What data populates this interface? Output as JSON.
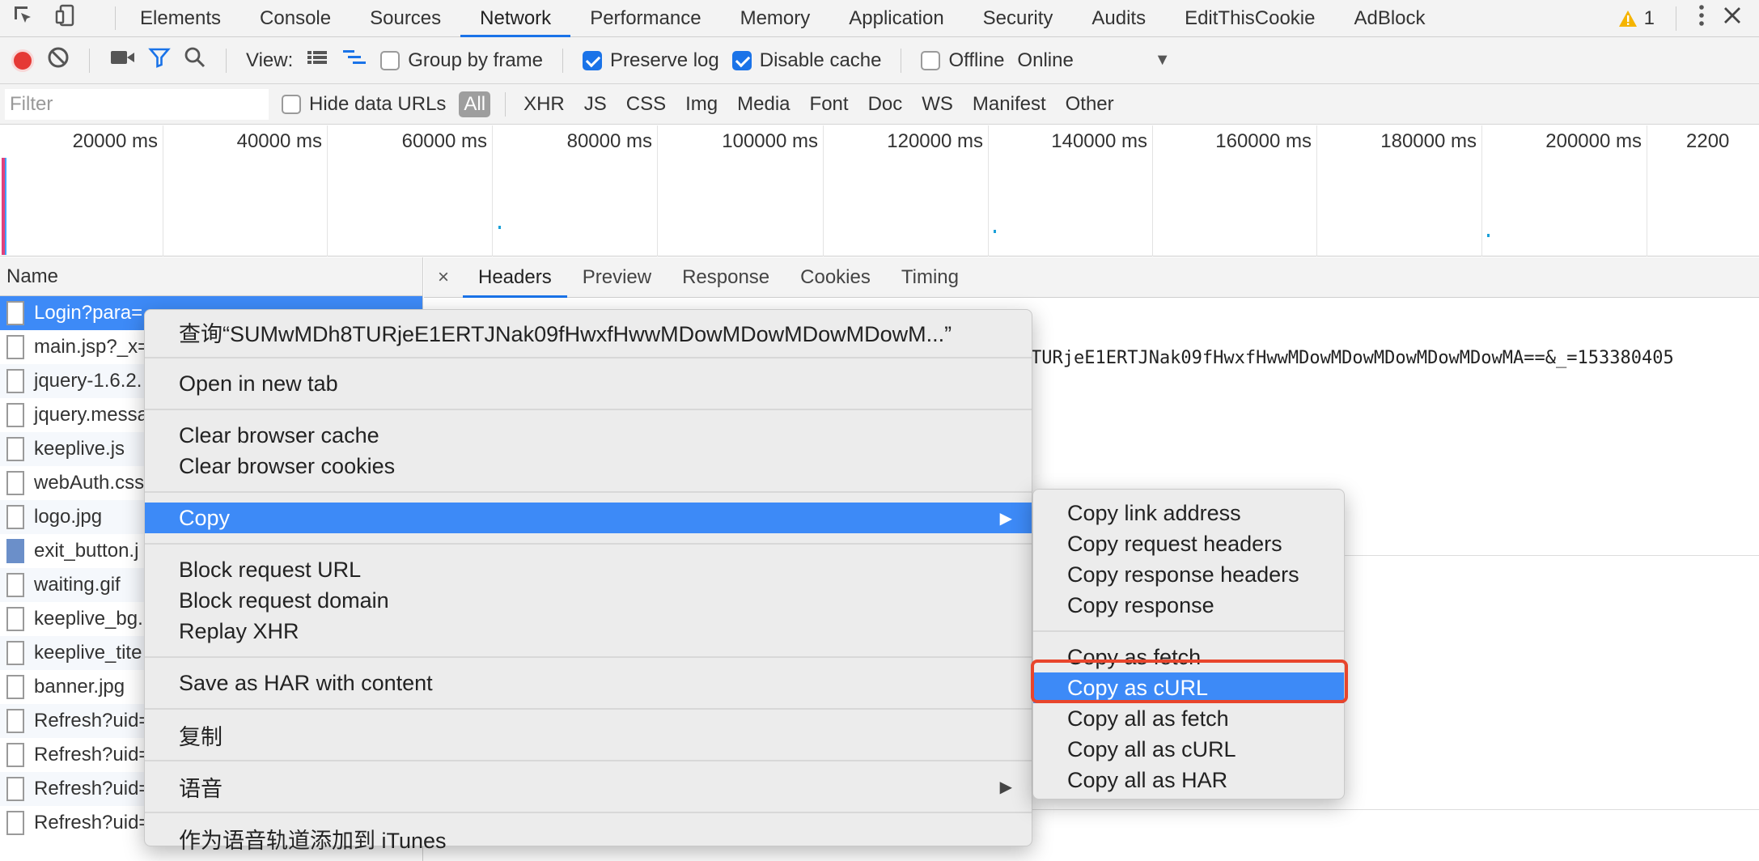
{
  "tabs": [
    "Elements",
    "Console",
    "Sources",
    "Network",
    "Performance",
    "Memory",
    "Application",
    "Security",
    "Audits",
    "EditThisCookie",
    "AdBlock"
  ],
  "active_tab": "Network",
  "warning_count": "1",
  "toolbar": {
    "view_label": "View:",
    "group_by_frame": "Group by frame",
    "preserve_log": "Preserve log",
    "disable_cache": "Disable cache",
    "offline": "Offline",
    "throttle": "Online"
  },
  "filter": {
    "placeholder": "Filter",
    "hide_data_urls": "Hide data URLs",
    "types": [
      "All",
      "XHR",
      "JS",
      "CSS",
      "Img",
      "Media",
      "Font",
      "Doc",
      "WS",
      "Manifest",
      "Other"
    ]
  },
  "timeline": {
    "ticks": [
      "20000 ms",
      "40000 ms",
      "60000 ms",
      "80000 ms",
      "100000 ms",
      "120000 ms",
      "140000 ms",
      "160000 ms",
      "180000 ms",
      "200000 ms",
      "2200"
    ]
  },
  "requests": {
    "header": "Name",
    "rows": [
      "Login?para=",
      "main.jsp?_x=",
      "jquery-1.6.2.",
      "jquery.messa",
      "keeplive.js",
      "webAuth.css",
      "logo.jpg",
      "exit_button.j",
      "waiting.gif",
      "keeplive_bg.",
      "keeplive_tite",
      "banner.jpg",
      "Refresh?uid=",
      "Refresh?uid=",
      "Refresh?uid=",
      "Refresh?uid="
    ]
  },
  "detail": {
    "close": "×",
    "tabs": [
      "Headers",
      "Preview",
      "Response",
      "Cookies",
      "Timing"
    ],
    "url_fragment": "TURjeE1ERTJNak09fHwxfHwwMDowMDowMDowMDowMDowMA==&_=153380405"
  },
  "context_menu": {
    "lookup": "查询“SUMwMDh8TURjeE1ERTJNak09fHwxfHwwMDowMDowMDowMDowM...”",
    "open_new_tab": "Open in new tab",
    "clear_cache": "Clear browser cache",
    "clear_cookies": "Clear browser cookies",
    "copy": "Copy",
    "block_url": "Block request URL",
    "block_domain": "Block request domain",
    "replay_xhr": "Replay XHR",
    "save_har": "Save as HAR with content",
    "fuzhi": "复制",
    "yuyin": "语音",
    "itunes": "作为语音轨道添加到 iTunes"
  },
  "copy_submenu": {
    "items": [
      "Copy link address",
      "Copy request headers",
      "Copy response headers",
      "Copy response",
      "Copy as fetch",
      "Copy as cURL",
      "Copy all as fetch",
      "Copy all as cURL",
      "Copy all as HAR"
    ],
    "highlighted": "Copy as cURL"
  },
  "colors": {
    "accent": "#1a73e8",
    "selection": "#3d8af7",
    "highlight_outline": "#e8452c",
    "record": "#e53935"
  }
}
